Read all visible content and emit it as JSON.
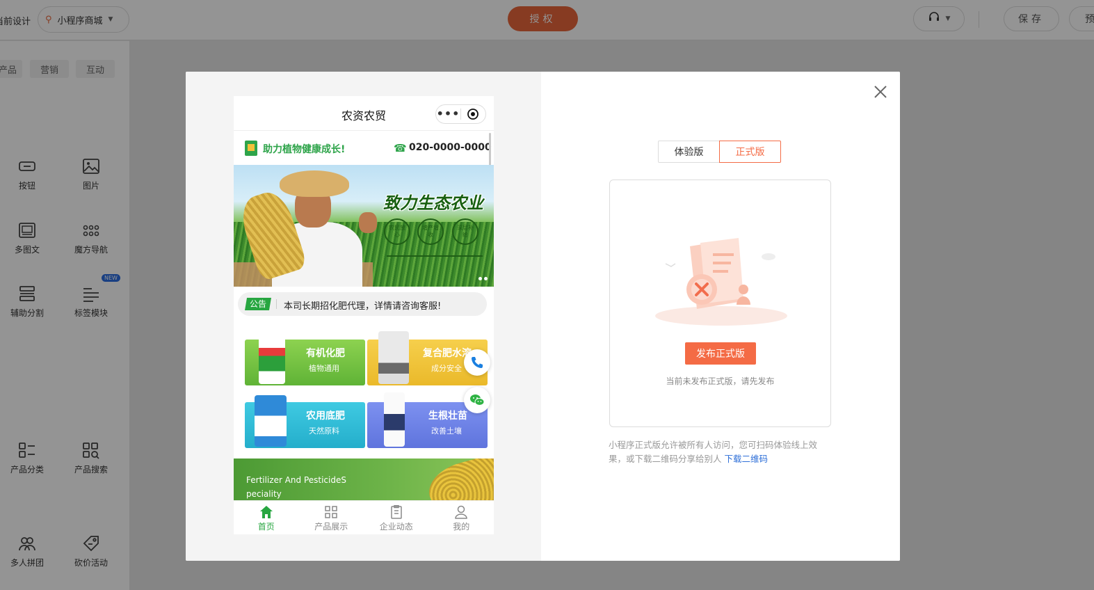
{
  "editor": {
    "crumb": "当前设计",
    "app_switch_label": "小程序商城",
    "authorize_label": "授权",
    "save_label": "保存",
    "preview_label": "预"
  },
  "sidebar": {
    "tabs": [
      "产品",
      "营销",
      "互动"
    ],
    "components": [
      {
        "label": "按钮",
        "icon": "button-icon"
      },
      {
        "label": "图片",
        "icon": "image-icon"
      },
      {
        "label": "多图文",
        "icon": "multi-image-text-icon"
      },
      {
        "label": "魔方导航",
        "icon": "cube-nav-icon"
      },
      {
        "label": "辅助分割",
        "icon": "divider-icon"
      },
      {
        "label": "标签模块",
        "icon": "tag-module-icon"
      },
      {
        "label": "产品分类",
        "icon": "product-category-icon"
      },
      {
        "label": "产品搜索",
        "icon": "product-search-icon"
      },
      {
        "label": "多人拼团",
        "icon": "group-buy-icon"
      },
      {
        "label": "砍价活动",
        "icon": "bargain-icon"
      }
    ],
    "new_badge": "NEW"
  },
  "phone": {
    "title": "农资农贸",
    "slogan": "助力植物健康成长!",
    "hotline": "020-0000-0000",
    "banner": {
      "title": "致力生态农业",
      "badges": [
        "农民放心",
        "增产增收",
        "深层补给"
      ]
    },
    "notice": {
      "tag": "公告",
      "text": "本司长期招化肥代理，详情请咨询客服!"
    },
    "cards": [
      {
        "title": "有机化肥",
        "subtitle": "植物通用",
        "color": "#7cc444"
      },
      {
        "title": "复合肥水溶",
        "subtitle": "成分安全",
        "color": "#f2c23c"
      },
      {
        "title": "农用底肥",
        "subtitle": "天然原料",
        "color": "#35bfd9"
      },
      {
        "title": "生根壮苗",
        "subtitle": "改善土壤",
        "color": "#6f83e8"
      }
    ],
    "bottom_banner_text": "Fertilizer And PesticideS peciality",
    "tabs": [
      {
        "label": "首页",
        "icon": "home-icon"
      },
      {
        "label": "产品展示",
        "icon": "grid-icon"
      },
      {
        "label": "企业动态",
        "icon": "clipboard-icon"
      },
      {
        "label": "我的",
        "icon": "user-icon"
      }
    ]
  },
  "publish_panel": {
    "tabs": [
      "体验版",
      "正式版"
    ],
    "active_tab": "正式版",
    "publish_button": "发布正式版",
    "empty_tip": "当前未发布正式版，请先发布",
    "description": "小程序正式版允许被所有人访问，您可扫码体验线上效果，或下载二维码分享给别人",
    "download_link": "下载二维码"
  },
  "colors": {
    "accent": "#f46b45",
    "brand_green": "#27a640",
    "authorize": "#e8673b"
  }
}
